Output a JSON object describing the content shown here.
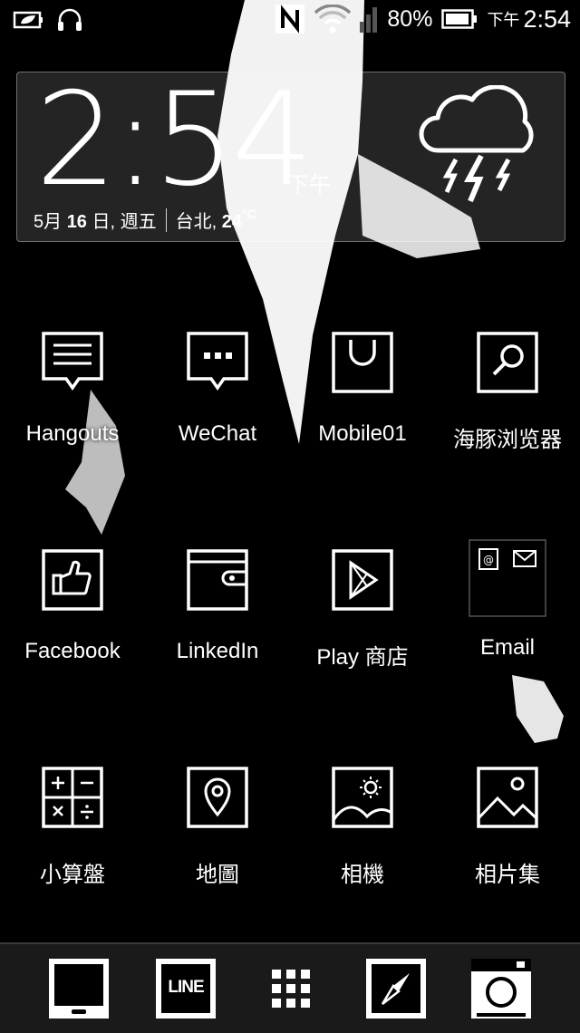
{
  "status_bar": {
    "battery_percent": "80%",
    "ampm": "下午",
    "time": "2:54",
    "icons_left": [
      "leaf-battery-icon",
      "headphones-icon"
    ],
    "icons_right": [
      "nfc-icon",
      "wifi-icon",
      "signal-icon",
      "battery-icon"
    ]
  },
  "clock_widget": {
    "time": "2:54",
    "ampm": "下午",
    "date_prefix": "5月",
    "date_day": "16",
    "date_suffix": "日, 週五",
    "city": "台北,",
    "temperature": "24",
    "temp_unit": "°C",
    "weather_icon": "thunderstorm-icon"
  },
  "apps": [
    {
      "label": "Hangouts",
      "icon": "hangouts-icon"
    },
    {
      "label": "WeChat",
      "icon": "wechat-icon"
    },
    {
      "label": "Mobile01",
      "icon": "mobile01-icon"
    },
    {
      "label": "海豚浏览器",
      "icon": "dolphin-browser-icon"
    },
    {
      "label": "Facebook",
      "icon": "facebook-icon"
    },
    {
      "label": "LinkedIn",
      "icon": "linkedin-icon"
    },
    {
      "label": "Play 商店",
      "icon": "play-store-icon"
    },
    {
      "label": "Email",
      "icon": "email-folder-icon"
    },
    {
      "label": "小算盤",
      "icon": "calculator-icon"
    },
    {
      "label": "地圖",
      "icon": "maps-icon"
    },
    {
      "label": "相機",
      "icon": "camera-scene-icon"
    },
    {
      "label": "相片集",
      "icon": "gallery-icon"
    }
  ],
  "dock": [
    {
      "icon": "tablet-icon"
    },
    {
      "icon": "line-icon",
      "text": "LINE"
    },
    {
      "icon": "app-drawer-icon"
    },
    {
      "icon": "compass-icon"
    },
    {
      "icon": "camera-icon"
    }
  ]
}
